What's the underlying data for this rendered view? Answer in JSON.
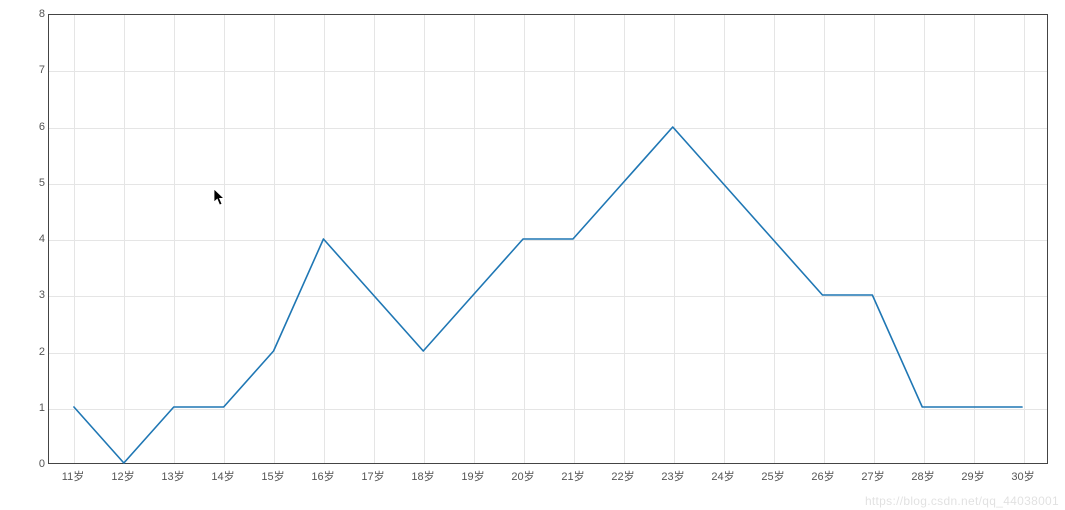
{
  "chart_data": {
    "type": "line",
    "categories": [
      "11岁",
      "12岁",
      "13岁",
      "14岁",
      "15岁",
      "16岁",
      "17岁",
      "18岁",
      "19岁",
      "20岁",
      "21岁",
      "22岁",
      "23岁",
      "24岁",
      "25岁",
      "26岁",
      "27岁",
      "28岁",
      "29岁",
      "30岁"
    ],
    "values": [
      1,
      0,
      1,
      1,
      2,
      4,
      3,
      2,
      3,
      4,
      4,
      5,
      6,
      5,
      4,
      3,
      3,
      1,
      1,
      1
    ],
    "yticks": [
      0,
      1,
      2,
      3,
      4,
      5,
      6,
      7,
      8
    ],
    "ylim": [
      0,
      8
    ],
    "title": "",
    "xlabel": "",
    "ylabel": "",
    "line_color": "#1f77b4",
    "grid_color": "#e5e5e5"
  },
  "watermark": {
    "text": "https://blog.csdn.net/qq_44038001"
  }
}
